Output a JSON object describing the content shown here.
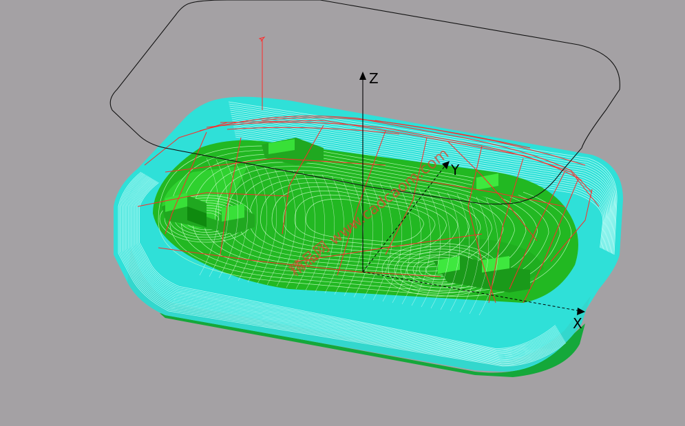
{
  "viewport": {
    "background_color": "#a4a1a4"
  },
  "axes": {
    "x_label": "X",
    "y_label": "Y",
    "z_label": "Z",
    "color": "#000000"
  },
  "part": {
    "stock_color": "#2fe0d8",
    "toolpath_color": "#00cc22",
    "base_color": "#14a83a",
    "highlight_color": "#7dff7d",
    "rapid_move_color": "#ff2a2a",
    "outline_color": "#111111"
  },
  "watermark": {
    "text": "精品网 www.cadcaom.com"
  }
}
